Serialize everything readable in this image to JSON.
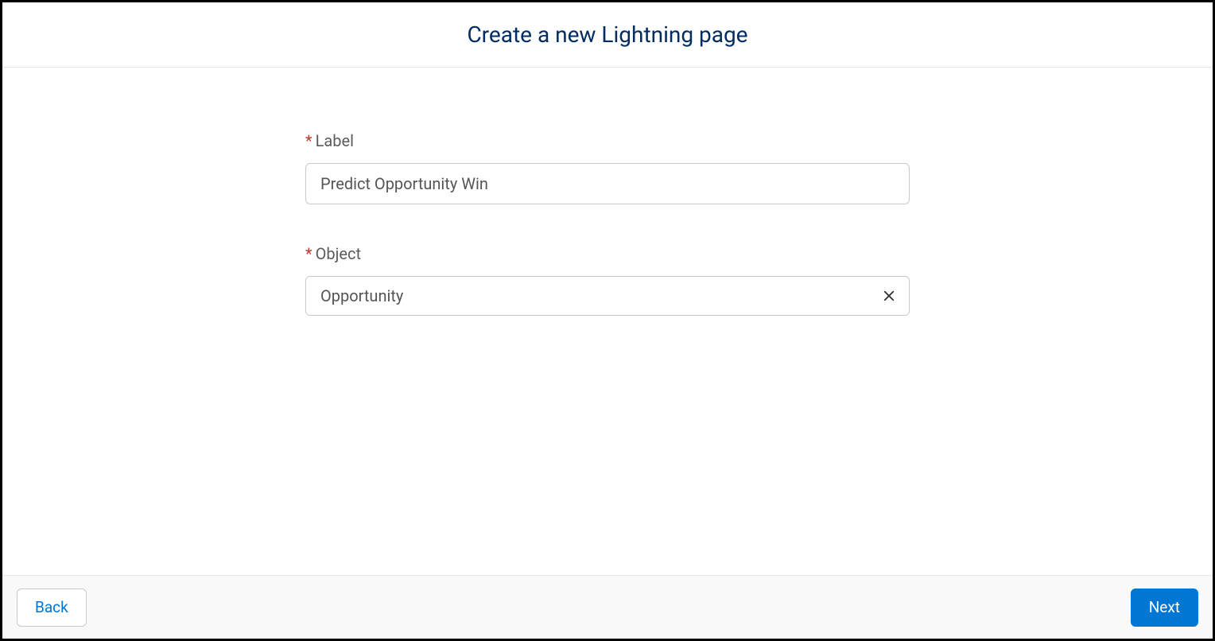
{
  "header": {
    "title": "Create a new Lightning page"
  },
  "form": {
    "label_field": {
      "label": "Label",
      "required_mark": "*",
      "value": "Predict Opportunity Win"
    },
    "object_field": {
      "label": "Object",
      "required_mark": "*",
      "value": "Opportunity"
    }
  },
  "footer": {
    "back_label": "Back",
    "next_label": "Next"
  }
}
